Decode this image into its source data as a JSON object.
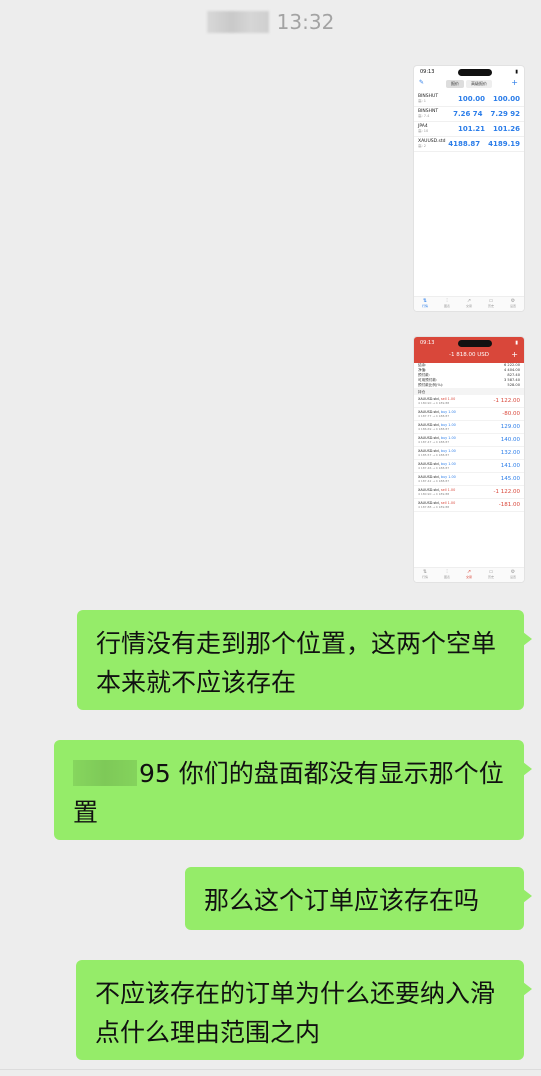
{
  "header": {
    "time": "13:32"
  },
  "thumb1": {
    "status_time": "09:13",
    "tabs": [
      "报价",
      "高级报价"
    ],
    "quotes": [
      {
        "symbol": "BINSHUT",
        "sub": "高: 1",
        "bid": "100.00",
        "ask": "100.00"
      },
      {
        "symbol": "BINSHNT",
        "sub": "高: 7.4",
        "bid": "7.26 74",
        "ask": "7.29 92"
      },
      {
        "symbol": "JPA4",
        "sub": "高: 10",
        "bid": "101.21",
        "ask": "101.26"
      },
      {
        "symbol": "XAUUSD.std",
        "sub": "高: 2",
        "bid": "4188.87",
        "ask": "4189.19"
      }
    ],
    "tabbar": [
      "行情",
      "图表",
      "交易",
      "历史",
      "设置"
    ]
  },
  "thumb2": {
    "status_time": "09:13",
    "header_amount": "-1 818.00 USD",
    "account": [
      {
        "label": "结余:",
        "value": "6 222.00"
      },
      {
        "label": "净值:",
        "value": "4 404.00"
      },
      {
        "label": "预付款:",
        "value": "827.40"
      },
      {
        "label": "可用预付款:",
        "value": "3 587.40"
      },
      {
        "label": "预付款比例(%):",
        "value": "528.00"
      }
    ],
    "positions_label": "持仓",
    "positions": [
      {
        "symbol": "XAUUSD.std,",
        "side": "sell 1.00",
        "detail": "4 180.90 → 4 189.88",
        "pl": "-1 122.00",
        "neg": true
      },
      {
        "symbol": "XAUUSD.std,",
        "side": "buy 1.00",
        "detail": "4 187.77 → 4 188.87",
        "pl": "-80.00",
        "neg": true
      },
      {
        "symbol": "XAUUSD.std,",
        "side": "buy 1.00",
        "detail": "4 186.69 → 4 188.87",
        "pl": "129.00",
        "neg": false
      },
      {
        "symbol": "XAUUSD.std,",
        "side": "buy 1.00",
        "detail": "4 187.47 → 4 188.87",
        "pl": "140.00",
        "neg": false
      },
      {
        "symbol": "XAUUSD.std,",
        "side": "buy 1.00",
        "detail": "4 185.57 → 4 188.87",
        "pl": "132.00",
        "neg": false
      },
      {
        "symbol": "XAUUSD.std,",
        "side": "buy 1.00",
        "detail": "4 187.46 → 4 188.87",
        "pl": "141.00",
        "neg": false
      },
      {
        "symbol": "XAUUSD.std,",
        "side": "buy 1.00",
        "detail": "4 187.42 → 4 188.87",
        "pl": "145.00",
        "neg": false
      },
      {
        "symbol": "XAUUSD.std,",
        "side": "sell 1.00",
        "detail": "4 180.90 → 4 189.88",
        "pl": "-1 122.00",
        "neg": true
      },
      {
        "symbol": "XAUUSD.std,",
        "side": "sell 1.00",
        "detail": "4 187.88 → 4 189.88",
        "pl": "-181.00",
        "neg": true
      }
    ],
    "tabbar": [
      "行情",
      "图表",
      "交易",
      "历史",
      "设置"
    ]
  },
  "messages": {
    "m1": "行情没有走到那个位置，这两个空单本来就不应该存在",
    "m2": "95 你们的盘面都没有显示那个位置",
    "m3": "那么这个订单应该存在吗",
    "m4": "不应该存在的订单为什么还要纳入滑点什么理由范围之内"
  }
}
